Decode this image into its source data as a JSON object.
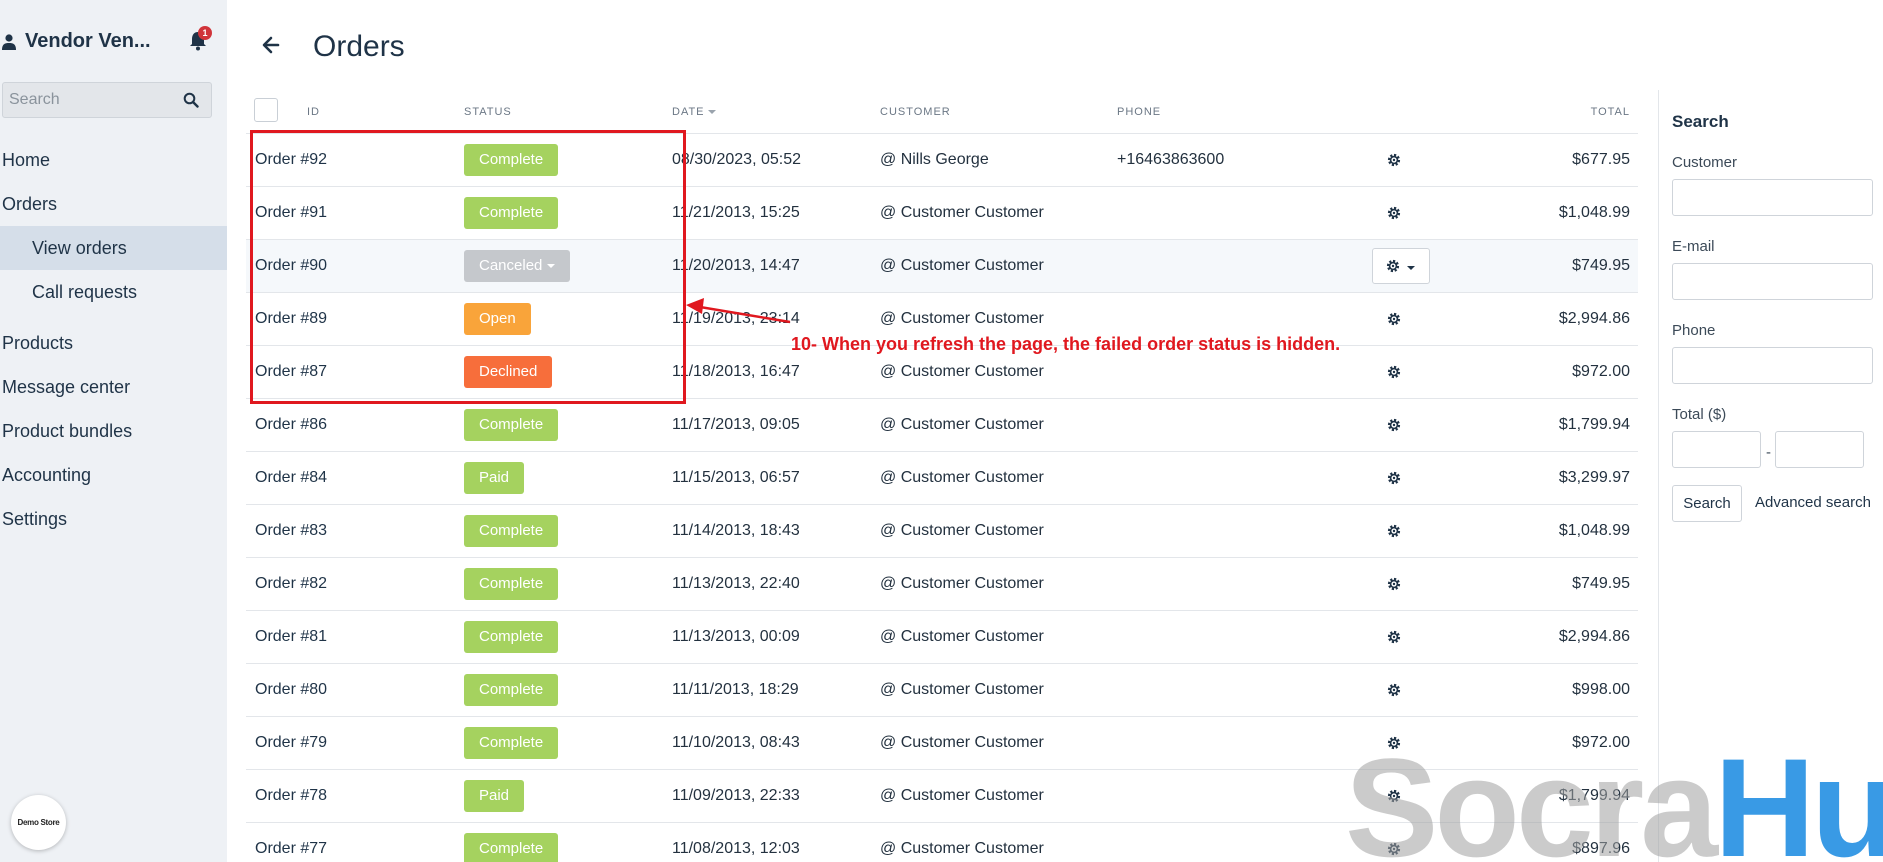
{
  "sidebar": {
    "title": "Vendor Ven...",
    "notification_count": "1",
    "search_placeholder": "Search",
    "nav": {
      "home": "Home",
      "orders": "Orders",
      "view_orders": "View orders",
      "call_requests": "Call requests",
      "products": "Products",
      "message_center": "Message center",
      "product_bundles": "Product bundles",
      "accounting": "Accounting",
      "settings": "Settings"
    },
    "demo_logo": "Demo Store"
  },
  "header": {
    "title": "Orders"
  },
  "table": {
    "columns": {
      "id": "ID",
      "status": "STATUS",
      "date": "DATE",
      "customer": "CUSTOMER",
      "phone": "PHONE",
      "total": "TOTAL"
    },
    "rows": [
      {
        "id": "Order #92",
        "status": "Complete",
        "date": "08/30/2023, 05:52",
        "customer": "@ Nills George",
        "phone": "+16463863600",
        "total": "$677.95"
      },
      {
        "id": "Order #91",
        "status": "Complete",
        "date": "11/21/2013, 15:25",
        "customer": "@ Customer Customer",
        "phone": "",
        "total": "$1,048.99"
      },
      {
        "id": "Order #90",
        "status": "Canceled",
        "date": "11/20/2013, 14:47",
        "customer": "@ Customer Customer",
        "phone": "",
        "total": "$749.95"
      },
      {
        "id": "Order #89",
        "status": "Open",
        "date": "11/19/2013, 23:14",
        "customer": "@ Customer Customer",
        "phone": "",
        "total": "$2,994.86"
      },
      {
        "id": "Order #87",
        "status": "Declined",
        "date": "11/18/2013, 16:47",
        "customer": "@ Customer Customer",
        "phone": "",
        "total": "$972.00"
      },
      {
        "id": "Order #86",
        "status": "Complete",
        "date": "11/17/2013, 09:05",
        "customer": "@ Customer Customer",
        "phone": "",
        "total": "$1,799.94"
      },
      {
        "id": "Order #84",
        "status": "Paid",
        "date": "11/15/2013, 06:57",
        "customer": "@ Customer Customer",
        "phone": "",
        "total": "$3,299.97"
      },
      {
        "id": "Order #83",
        "status": "Complete",
        "date": "11/14/2013, 18:43",
        "customer": "@ Customer Customer",
        "phone": "",
        "total": "$1,048.99"
      },
      {
        "id": "Order #82",
        "status": "Complete",
        "date": "11/13/2013, 22:40",
        "customer": "@ Customer Customer",
        "phone": "",
        "total": "$749.95"
      },
      {
        "id": "Order #81",
        "status": "Complete",
        "date": "11/13/2013, 00:09",
        "customer": "@ Customer Customer",
        "phone": "",
        "total": "$2,994.86"
      },
      {
        "id": "Order #80",
        "status": "Complete",
        "date": "11/11/2013, 18:29",
        "customer": "@ Customer Customer",
        "phone": "",
        "total": "$998.00"
      },
      {
        "id": "Order #79",
        "status": "Complete",
        "date": "11/10/2013, 08:43",
        "customer": "@ Customer Customer",
        "phone": "",
        "total": "$972.00"
      },
      {
        "id": "Order #78",
        "status": "Paid",
        "date": "11/09/2013, 22:33",
        "customer": "@ Customer Customer",
        "phone": "",
        "total": "$1,799.94"
      },
      {
        "id": "Order #77",
        "status": "Complete",
        "date": "11/08/2013, 12:03",
        "customer": "@ Customer Customer",
        "phone": "",
        "total": "$897.96"
      }
    ]
  },
  "status_colors": {
    "Complete": "#a5d25f",
    "Canceled": "#c5c8cc",
    "Open": "#f9a43a",
    "Declined": "#f76e3b",
    "Paid": "#a5d25f"
  },
  "search_panel": {
    "title": "Search",
    "customer_label": "Customer",
    "email_label": "E-mail",
    "phone_label": "Phone",
    "total_label": "Total ($)",
    "range_separator": "-",
    "search_button": "Search",
    "advanced_link": "Advanced search"
  },
  "annotation": {
    "text": "10- When you refresh the page, the failed order status is hidden.",
    "color": "#e0181f"
  },
  "watermark": {
    "part1": "Socra",
    "part2": "Hub"
  },
  "icons": {
    "user": "user-icon",
    "bell": "bell-icon",
    "search": "search-icon",
    "back": "back-arrow-icon",
    "gear": "gear-icon"
  }
}
